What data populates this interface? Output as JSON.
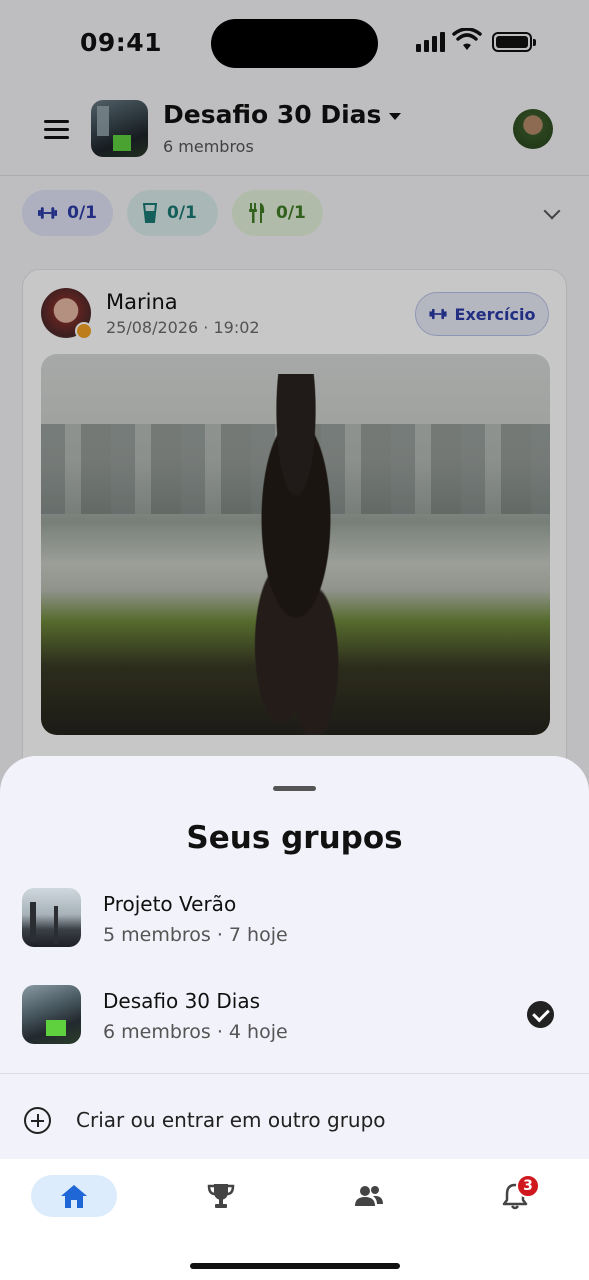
{
  "status_bar": {
    "time": "09:41"
  },
  "header": {
    "group_title": "Desafio 30 Dias",
    "group_subtitle": "6 membros"
  },
  "chips": [
    {
      "label": "0/1",
      "icon": "dumbbell-icon",
      "color": "#2b3ca6"
    },
    {
      "label": "0/1",
      "icon": "water-glass-icon",
      "color": "#1a7a74"
    },
    {
      "label": "0/1",
      "icon": "fork-knife-icon",
      "color": "#3f7d24"
    }
  ],
  "post": {
    "author": "Marina",
    "date": "25/08/2026 · 19:02",
    "tag": "Exercício"
  },
  "sheet": {
    "title": "Seus grupos",
    "groups": [
      {
        "name": "Projeto Verão",
        "meta": "5 membros · 7 hoje",
        "selected": false
      },
      {
        "name": "Desafio 30 Dias",
        "meta": "6 membros · 4 hoje",
        "selected": true
      }
    ],
    "create_label": "Criar ou entrar em outro grupo"
  },
  "tabbar": {
    "items": [
      {
        "icon": "home-icon",
        "active": true
      },
      {
        "icon": "trophy-icon",
        "active": false
      },
      {
        "icon": "people-icon",
        "active": false
      },
      {
        "icon": "bell-icon",
        "active": false
      }
    ],
    "notification_count": "3",
    "accent": "#1f66d6"
  }
}
